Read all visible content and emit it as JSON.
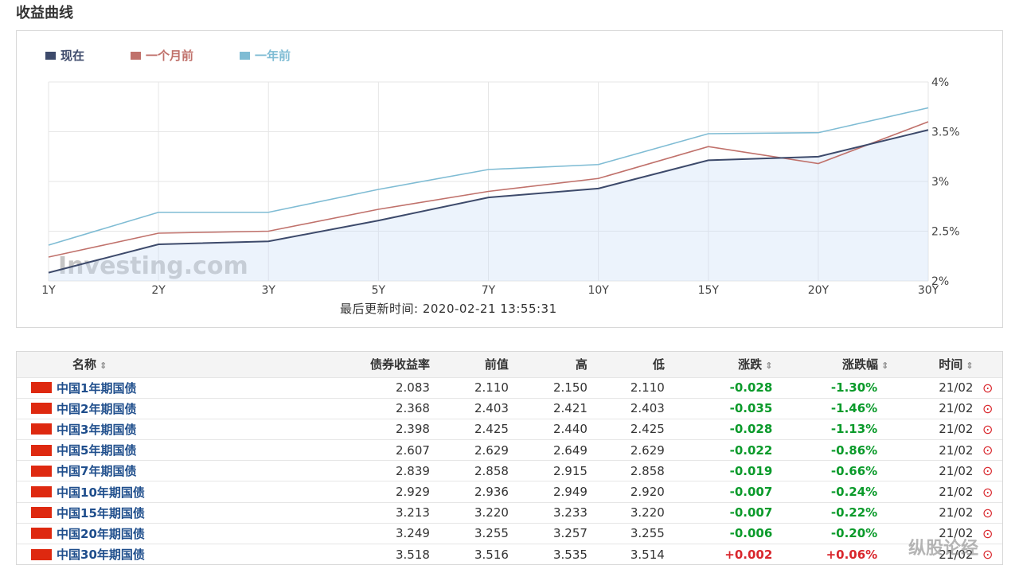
{
  "page": {
    "title": "收益曲线"
  },
  "chart_data": {
    "type": "line",
    "categories": [
      "1Y",
      "2Y",
      "3Y",
      "5Y",
      "7Y",
      "10Y",
      "15Y",
      "20Y",
      "30Y"
    ],
    "series": [
      {
        "name": "现在",
        "color": "#3d4a6b",
        "values": [
          2.083,
          2.368,
          2.398,
          2.607,
          2.839,
          2.929,
          3.213,
          3.249,
          3.518
        ]
      },
      {
        "name": "一个月前",
        "color": "#c0716b",
        "values": [
          2.24,
          2.48,
          2.5,
          2.72,
          2.9,
          3.03,
          3.35,
          3.18,
          3.6
        ]
      },
      {
        "name": "一年前",
        "color": "#7fbcd4",
        "values": [
          2.36,
          2.69,
          2.69,
          2.92,
          3.12,
          3.17,
          3.48,
          3.49,
          3.74
        ]
      }
    ],
    "y_ticks": [
      "2%",
      "2.5%",
      "3%",
      "3.5%",
      "4%"
    ],
    "ylim": [
      2.0,
      4.0
    ],
    "grid": true,
    "legend_position": "top-left",
    "watermark": "Investing.com"
  },
  "chart": {
    "updated": "最后更新时间: 2020-02-21 13:55:31"
  },
  "table": {
    "headers": [
      "名称",
      "债券收益率",
      "前值",
      "高",
      "低",
      "涨跌",
      "涨跌幅",
      "时间"
    ],
    "rows": [
      {
        "name": "中国1年期国债",
        "yield": "2.083",
        "prev": "2.110",
        "high": "2.150",
        "low": "2.110",
        "chg": "-0.028",
        "chg_pct": "-1.30%",
        "time": "21/02"
      },
      {
        "name": "中国2年期国债",
        "yield": "2.368",
        "prev": "2.403",
        "high": "2.421",
        "low": "2.403",
        "chg": "-0.035",
        "chg_pct": "-1.46%",
        "time": "21/02"
      },
      {
        "name": "中国3年期国债",
        "yield": "2.398",
        "prev": "2.425",
        "high": "2.440",
        "low": "2.425",
        "chg": "-0.028",
        "chg_pct": "-1.13%",
        "time": "21/02"
      },
      {
        "name": "中国5年期国债",
        "yield": "2.607",
        "prev": "2.629",
        "high": "2.649",
        "low": "2.629",
        "chg": "-0.022",
        "chg_pct": "-0.86%",
        "time": "21/02"
      },
      {
        "name": "中国7年期国债",
        "yield": "2.839",
        "prev": "2.858",
        "high": "2.915",
        "low": "2.858",
        "chg": "-0.019",
        "chg_pct": "-0.66%",
        "time": "21/02"
      },
      {
        "name": "中国10年期国债",
        "yield": "2.929",
        "prev": "2.936",
        "high": "2.949",
        "low": "2.920",
        "chg": "-0.007",
        "chg_pct": "-0.24%",
        "time": "21/02"
      },
      {
        "name": "中国15年期国债",
        "yield": "3.213",
        "prev": "3.220",
        "high": "3.233",
        "low": "3.220",
        "chg": "-0.007",
        "chg_pct": "-0.22%",
        "time": "21/02"
      },
      {
        "name": "中国20年期国债",
        "yield": "3.249",
        "prev": "3.255",
        "high": "3.257",
        "low": "3.255",
        "chg": "-0.006",
        "chg_pct": "-0.20%",
        "time": "21/02"
      },
      {
        "name": "中国30年期国债",
        "yield": "3.518",
        "prev": "3.516",
        "high": "3.535",
        "low": "3.514",
        "chg": "+0.002",
        "chg_pct": "+0.06%",
        "time": "21/02"
      }
    ]
  },
  "watermark": "纵股论经"
}
